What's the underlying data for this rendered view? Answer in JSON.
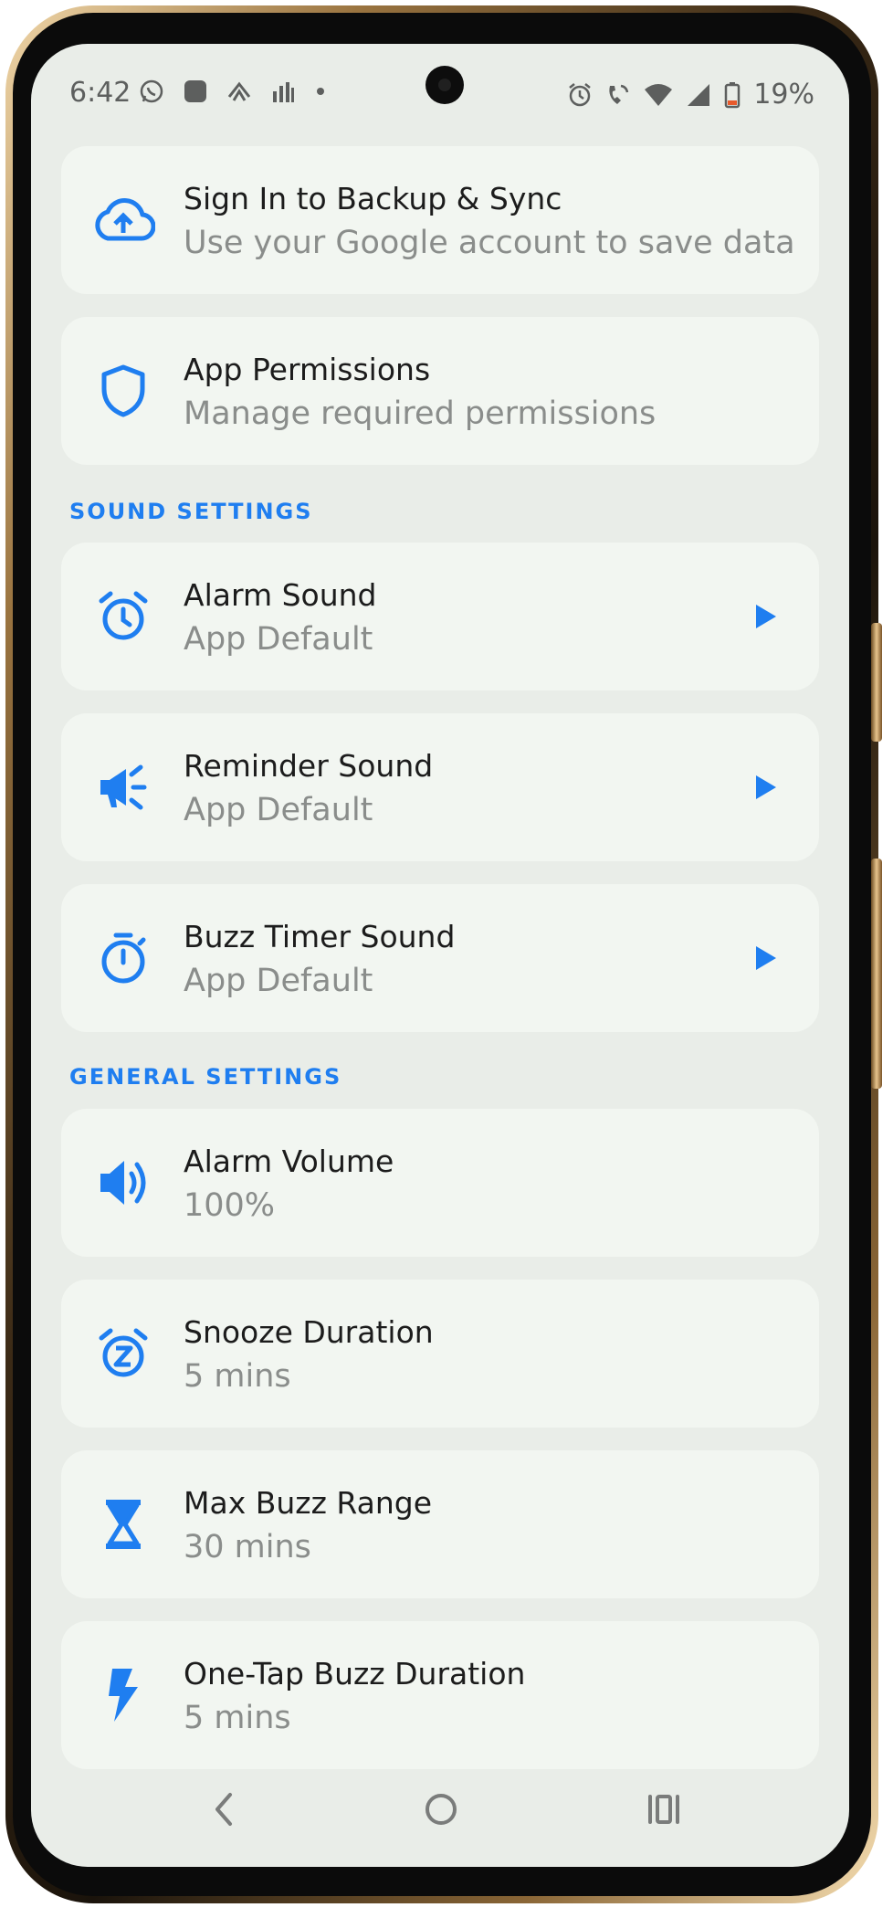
{
  "status_bar": {
    "time": "6:42",
    "battery": "19%",
    "left_icons": [
      "whatsapp-icon",
      "app-square-icon",
      "signal-app-icon",
      "notification-icon",
      "dot-icon"
    ],
    "right_icons": [
      "alarm-icon",
      "wifi-calling-icon",
      "wifi-icon",
      "cellular-icon",
      "battery-icon"
    ]
  },
  "cards": {
    "backup": {
      "title": "Sign In to Backup & Sync",
      "subtitle": "Use your Google account to save data",
      "icon": "cloud-upload-icon"
    },
    "permissions": {
      "title": "App Permissions",
      "subtitle": "Manage required permissions",
      "icon": "shield-icon"
    }
  },
  "sound_settings": {
    "header": "SOUND SETTINGS",
    "items": [
      {
        "title": "Alarm Sound",
        "value": "App Default",
        "icon": "alarm-clock-icon"
      },
      {
        "title": "Reminder Sound",
        "value": "App Default",
        "icon": "megaphone-icon"
      },
      {
        "title": "Buzz Timer Sound",
        "value": "App Default",
        "icon": "stopwatch-icon"
      }
    ]
  },
  "general_settings": {
    "header": "GENERAL SETTINGS",
    "items": [
      {
        "title": "Alarm Volume",
        "value": "100%",
        "icon": "volume-icon"
      },
      {
        "title": "Snooze Duration",
        "value": "5 mins",
        "icon": "snooze-icon"
      },
      {
        "title": "Max Buzz Range",
        "value": "30 mins",
        "icon": "hourglass-icon"
      },
      {
        "title": "One-Tap Buzz Duration",
        "value": "5 mins",
        "icon": "lightning-icon"
      }
    ]
  },
  "colors": {
    "accent": "#1f7ef0",
    "card_bg": "#f2f6f1",
    "screen_bg": "#e9ede8",
    "title_text": "#1c1c1c",
    "subtitle_text": "#8a8d8b"
  },
  "navigation": [
    "back-icon",
    "home-icon",
    "recent-apps-icon"
  ]
}
